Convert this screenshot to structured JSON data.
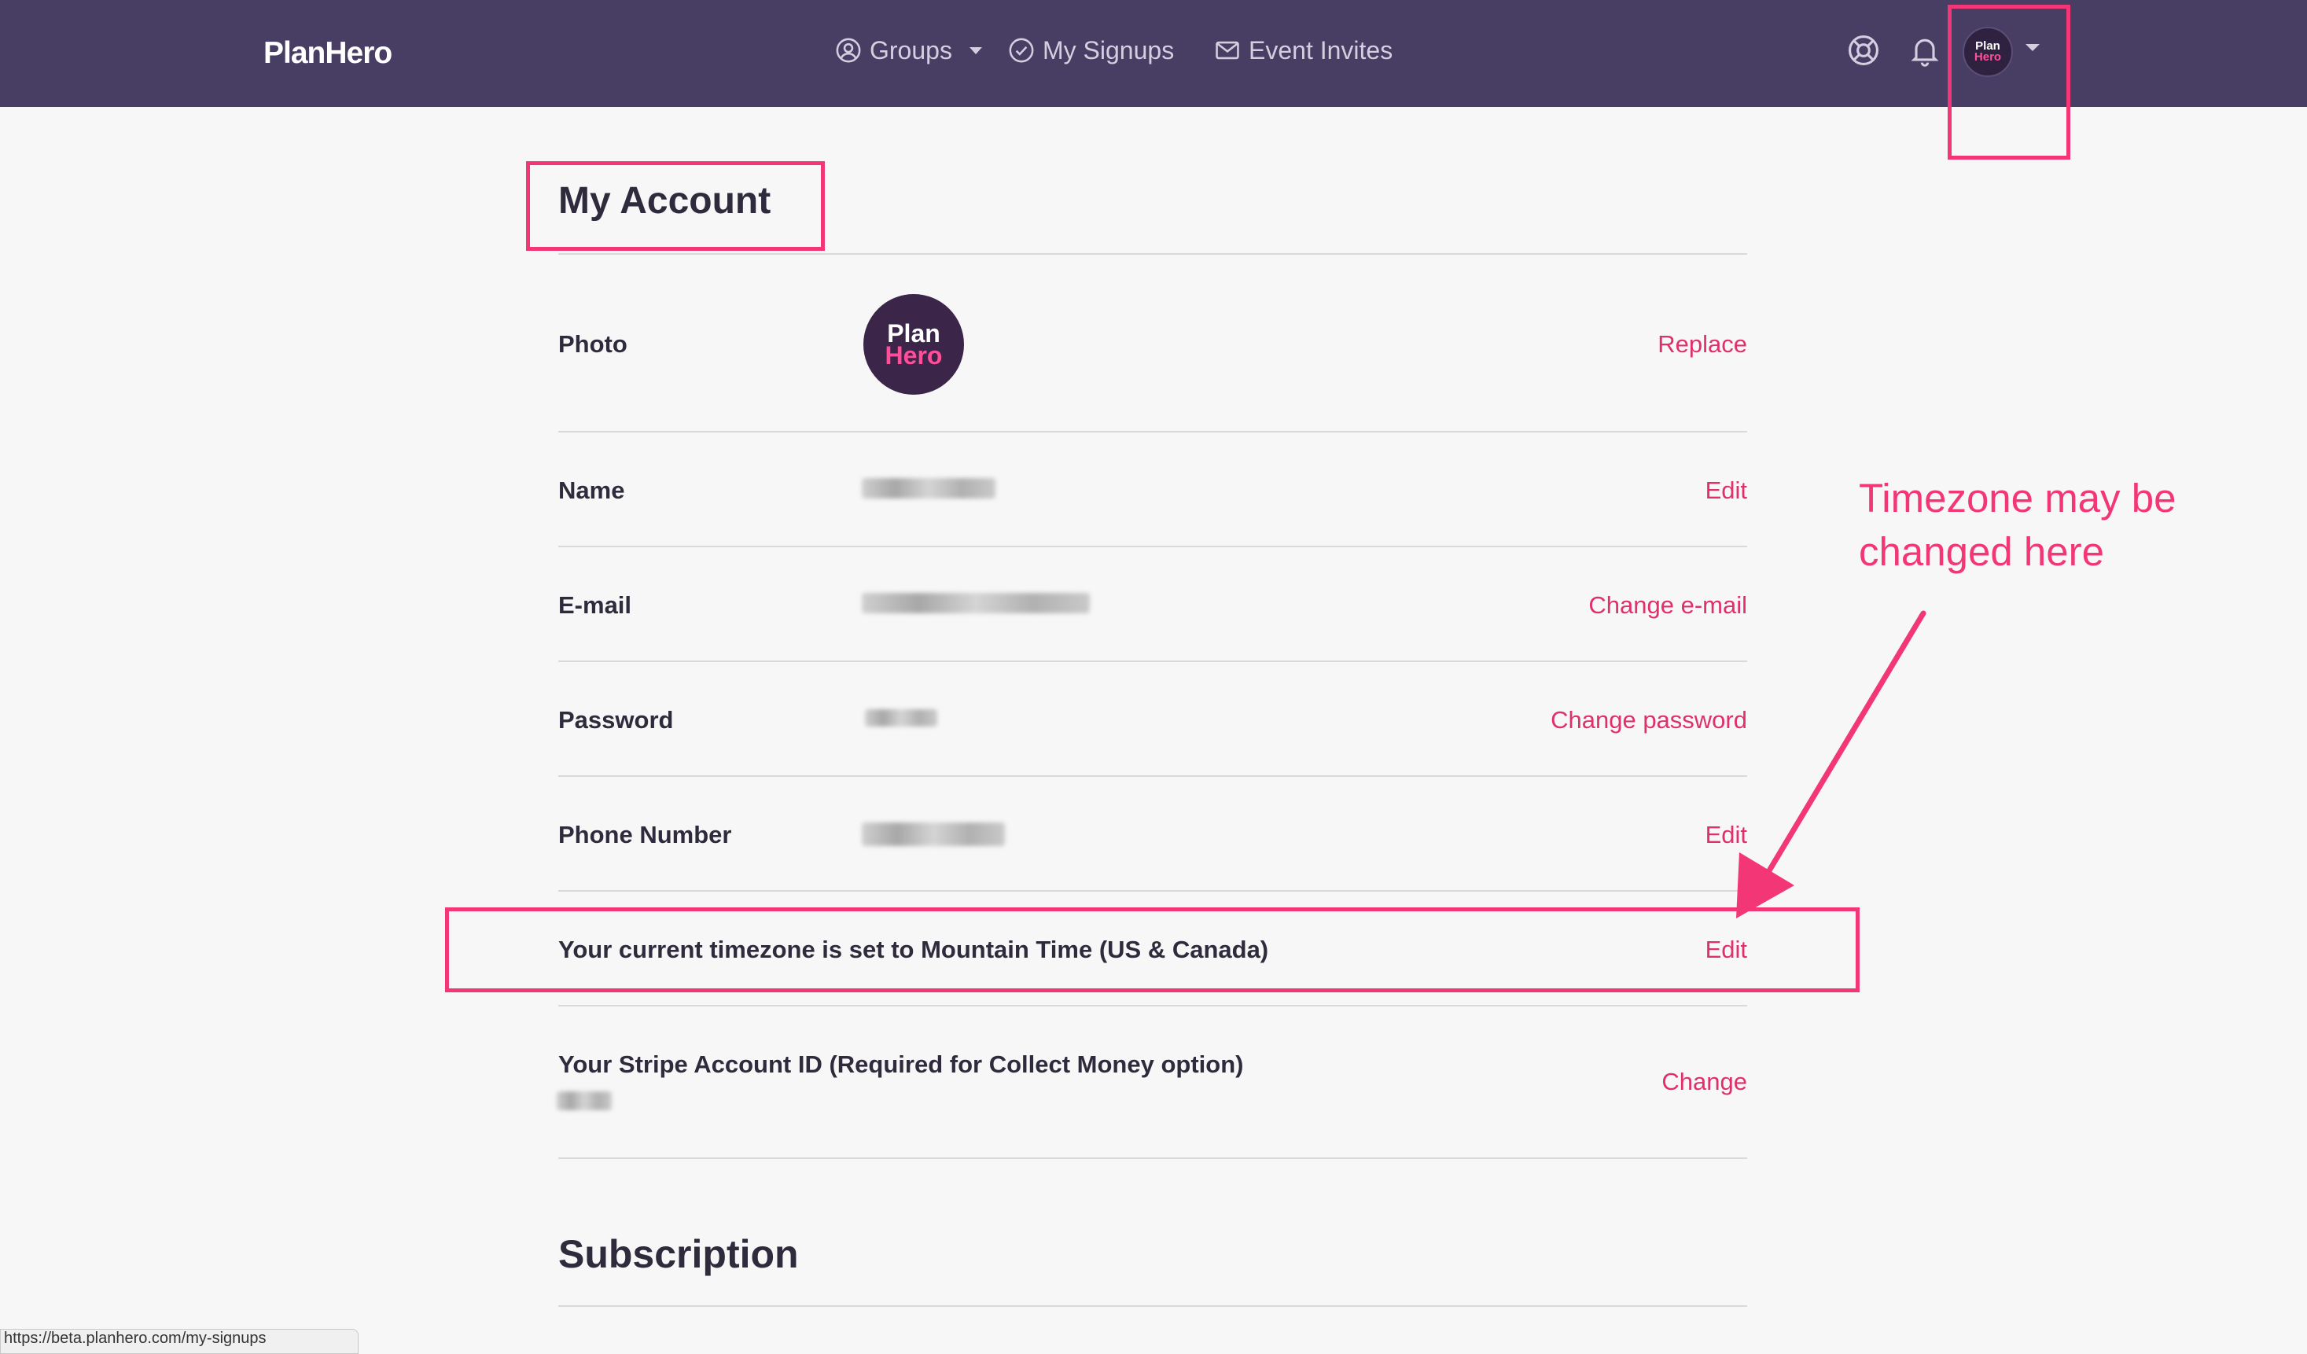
{
  "navbar": {
    "logo": "PlanHero",
    "items": [
      {
        "label": "Groups"
      },
      {
        "label": "My Signups"
      },
      {
        "label": "Event Invites"
      }
    ],
    "avatar": {
      "line1": "Plan",
      "line2": "Hero"
    },
    "colors": {
      "background": "#483d63",
      "text": "#d3cfe0"
    }
  },
  "account": {
    "title": "My Account",
    "photo": {
      "label": "Photo",
      "avatar_line1": "Plan",
      "avatar_line2": "Hero",
      "action": "Replace"
    },
    "name": {
      "label": "Name",
      "action": "Edit"
    },
    "email": {
      "label": "E-mail",
      "action": "Change e-mail"
    },
    "password": {
      "label": "Password",
      "action": "Change password"
    },
    "phone": {
      "label": "Phone Number",
      "action": "Edit"
    },
    "timezone": {
      "text": "Your current timezone is set to Mountain Time (US & Canada)",
      "action": "Edit"
    },
    "stripe": {
      "label": "Your Stripe Account ID (Required for Collect Money option)",
      "action": "Change"
    },
    "accent_color": "#e0306a"
  },
  "subscription": {
    "title": "Subscription"
  },
  "status_bar": {
    "url": "https://beta.planhero.com/my-signups"
  },
  "annotation": {
    "line1": "Timezone may be",
    "line2": "changed here",
    "color": "#f23676"
  }
}
